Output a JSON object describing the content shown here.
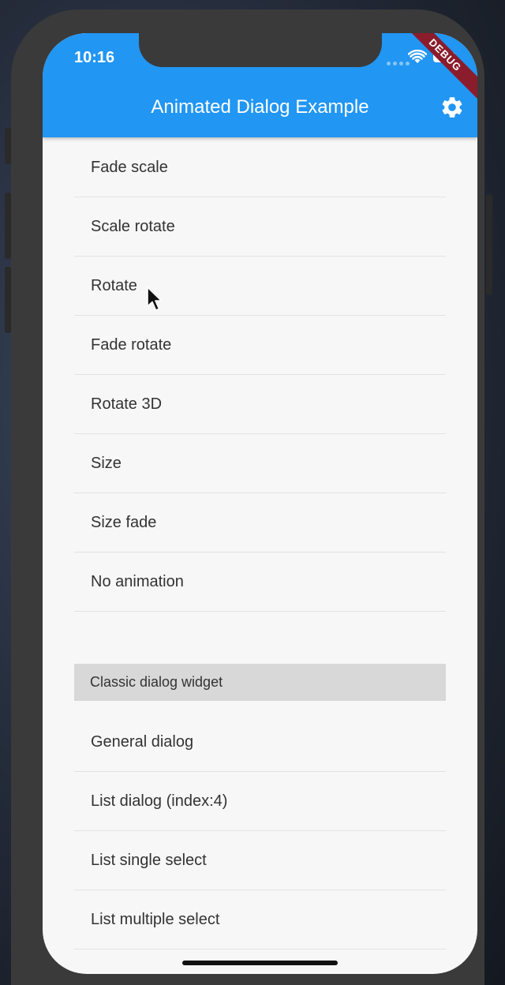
{
  "status_bar": {
    "time": "10:16"
  },
  "app_bar": {
    "title": "Animated Dialog Example",
    "color": "#2196f3",
    "action_icon": "gear-icon"
  },
  "debug_banner": "DEBUG",
  "animation_items": [
    {
      "label": "Fade scale"
    },
    {
      "label": "Scale rotate"
    },
    {
      "label": "Rotate"
    },
    {
      "label": "Fade rotate"
    },
    {
      "label": "Rotate 3D"
    },
    {
      "label": "Size"
    },
    {
      "label": "Size fade"
    },
    {
      "label": "No animation"
    }
  ],
  "classic_section": {
    "header": "Classic dialog widget",
    "items": [
      {
        "label": "General dialog"
      },
      {
        "label": "List dialog (index:4)"
      },
      {
        "label": "List single select"
      },
      {
        "label": "List multiple select"
      }
    ]
  }
}
